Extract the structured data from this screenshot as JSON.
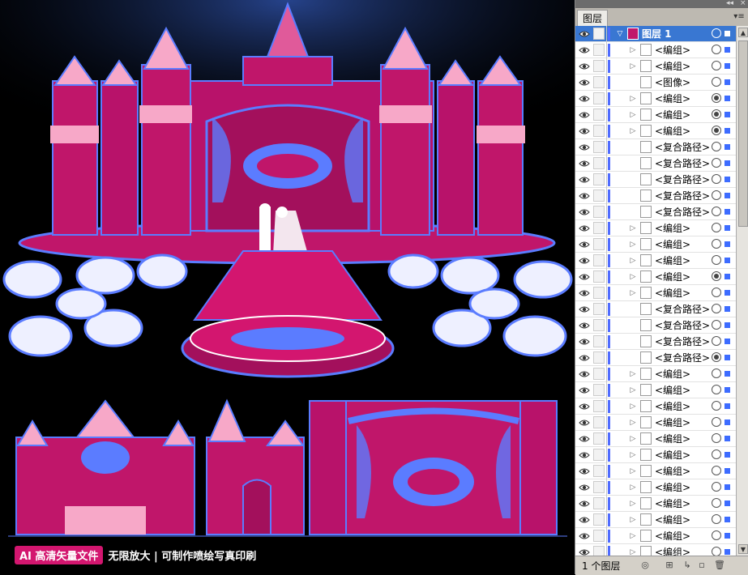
{
  "banner": {
    "badge": "AI 高清矢量文件",
    "text": "无限放大 | 可制作喷绘写真印刷"
  },
  "panel": {
    "tab_label": "图层",
    "top_controls": [
      "◂◂",
      "×"
    ],
    "menu_icon": "menu-icon",
    "layer_count_text": "1 个图层",
    "accent_color": "#3977d2"
  },
  "layers": [
    {
      "label": "图层 1",
      "top": true,
      "expand": "▽",
      "target": "ring"
    },
    {
      "label": "<编组>",
      "expand": "▷",
      "target": "ring"
    },
    {
      "label": "<编组>",
      "expand": "▷",
      "target": "ring"
    },
    {
      "label": "<图像>",
      "expand": "",
      "target": "ring"
    },
    {
      "label": "<编组>",
      "expand": "▷",
      "target": "filled"
    },
    {
      "label": "<编组>",
      "expand": "▷",
      "target": "filled"
    },
    {
      "label": "<编组>",
      "expand": "▷",
      "target": "filled"
    },
    {
      "label": "<复合路径>",
      "expand": "",
      "target": "ring"
    },
    {
      "label": "<复合路径>",
      "expand": "",
      "target": "ring"
    },
    {
      "label": "<复合路径>",
      "expand": "",
      "target": "ring"
    },
    {
      "label": "<复合路径>",
      "expand": "",
      "target": "ring"
    },
    {
      "label": "<复合路径>",
      "expand": "",
      "target": "ring"
    },
    {
      "label": "<编组>",
      "expand": "▷",
      "target": "ring"
    },
    {
      "label": "<编组>",
      "expand": "▷",
      "target": "ring"
    },
    {
      "label": "<编组>",
      "expand": "▷",
      "target": "ring"
    },
    {
      "label": "<编组>",
      "expand": "▷",
      "target": "filled"
    },
    {
      "label": "<编组>",
      "expand": "▷",
      "target": "ring"
    },
    {
      "label": "<复合路径>",
      "expand": "",
      "target": "ring"
    },
    {
      "label": "<复合路径>",
      "expand": "",
      "target": "ring"
    },
    {
      "label": "<复合路径>",
      "expand": "",
      "target": "ring"
    },
    {
      "label": "<复合路径>",
      "expand": "",
      "target": "filled"
    },
    {
      "label": "<编组>",
      "expand": "▷",
      "target": "ring"
    },
    {
      "label": "<编组>",
      "expand": "▷",
      "target": "ring"
    },
    {
      "label": "<编组>",
      "expand": "▷",
      "target": "ring"
    },
    {
      "label": "<编组>",
      "expand": "▷",
      "target": "ring"
    },
    {
      "label": "<编组>",
      "expand": "▷",
      "target": "ring"
    },
    {
      "label": "<编组>",
      "expand": "▷",
      "target": "ring"
    },
    {
      "label": "<编组>",
      "expand": "▷",
      "target": "ring"
    },
    {
      "label": "<编组>",
      "expand": "▷",
      "target": "ring"
    },
    {
      "label": "<编组>",
      "expand": "▷",
      "target": "ring"
    },
    {
      "label": "<编组>",
      "expand": "▷",
      "target": "ring"
    },
    {
      "label": "<编组>",
      "expand": "▷",
      "target": "ring"
    },
    {
      "label": "<编组>",
      "expand": "▷",
      "target": "ring"
    }
  ],
  "colors": {
    "magenta": "#d3166f",
    "blue": "#5b7cff",
    "pink": "#f7a8c8"
  }
}
